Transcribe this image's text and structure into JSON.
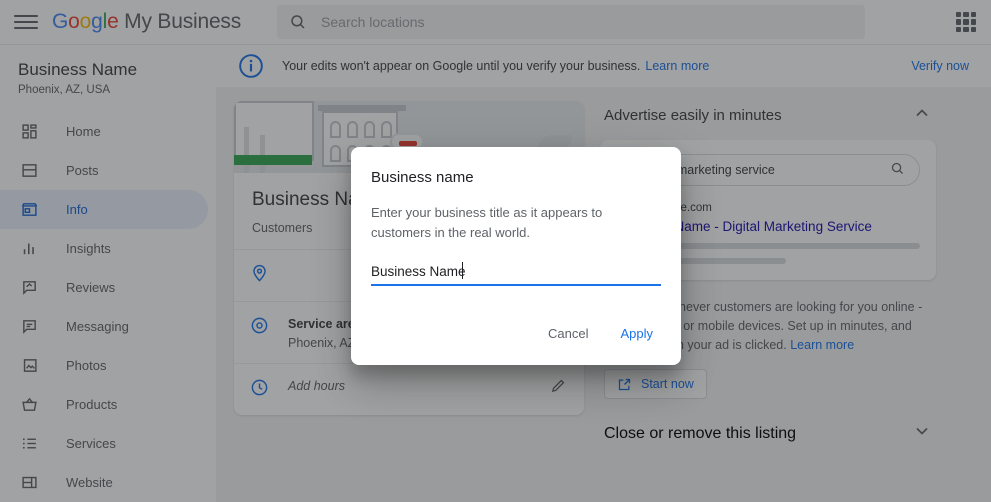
{
  "header": {
    "menu_icon": "hamburger-icon",
    "brand_google": [
      "G",
      "o",
      "o",
      "g",
      "l",
      "e"
    ],
    "brand_suffix": " My Business",
    "search_placeholder": "Search locations",
    "search_value": "",
    "search_icon": "search-icon",
    "apps_icon": "apps-grid-icon"
  },
  "sidebar": {
    "business_name": "Business Name",
    "business_location": "Phoenix, AZ, USA",
    "items": [
      {
        "label": "Home",
        "icon": "dashboard-icon",
        "active": false
      },
      {
        "label": "Posts",
        "icon": "posts-icon",
        "active": false
      },
      {
        "label": "Info",
        "icon": "storefront-icon",
        "active": true
      },
      {
        "label": "Insights",
        "icon": "bar-chart-icon",
        "active": false
      },
      {
        "label": "Reviews",
        "icon": "review-icon",
        "active": false
      },
      {
        "label": "Messaging",
        "icon": "message-icon",
        "active": false
      },
      {
        "label": "Photos",
        "icon": "photo-icon",
        "active": false
      },
      {
        "label": "Products",
        "icon": "basket-icon",
        "active": false
      },
      {
        "label": "Services",
        "icon": "list-icon",
        "active": false
      },
      {
        "label": "Website",
        "icon": "website-icon",
        "active": false
      }
    ]
  },
  "notice": {
    "icon": "info-icon",
    "text": "Your edits won't appear on Google until you verify your business.",
    "learn_more": "Learn more",
    "verify_now": "Verify now"
  },
  "info_card": {
    "title": "Business Name",
    "subtitle": "Customers",
    "rows": [
      {
        "icon": "location-pin-icon",
        "title": "",
        "subtitle": "",
        "placeholder": ""
      },
      {
        "icon": "service-area-icon",
        "title": "Service areas",
        "subtitle": "Phoenix, AZ, USA",
        "placeholder": "",
        "edit_icon": "pencil-icon"
      },
      {
        "icon": "clock-icon",
        "title": "",
        "subtitle": "",
        "placeholder": "Add hours",
        "edit_icon": "pencil-icon"
      }
    ]
  },
  "advertise": {
    "section_title": "Advertise easily in minutes",
    "collapse_icon": "chevron-up-icon",
    "search_query": "Internet marketing service",
    "search_icon": "search-icon",
    "preview_url": "www.example.com",
    "preview_title": "Business Name - Digital Marketing Service",
    "body_text": "Show up whenever customers are looking for you online - on computers or mobile devices. Set up in minutes, and only pay when your ad is clicked.",
    "body_link": "Learn more",
    "start_button": "Start now",
    "start_icon": "external-link-icon"
  },
  "close_listing": {
    "section_title": "Close or remove this listing",
    "expand_icon": "chevron-down-icon"
  },
  "modal": {
    "title": "Business name",
    "description": "Enter your business title as it appears to customers in the real world.",
    "input_value": "Business Name",
    "input_placeholder": "Business name",
    "cancel_label": "Cancel",
    "apply_label": "Apply"
  },
  "colors": {
    "accent_blue": "#1a73e8",
    "link_blue": "#1a0dab",
    "grey_text": "#5f6368",
    "dark_text": "#202124",
    "active_pill": "#e8f0fe",
    "green": "#34a853",
    "red": "#ea4335",
    "yellow": "#fbbc05"
  }
}
